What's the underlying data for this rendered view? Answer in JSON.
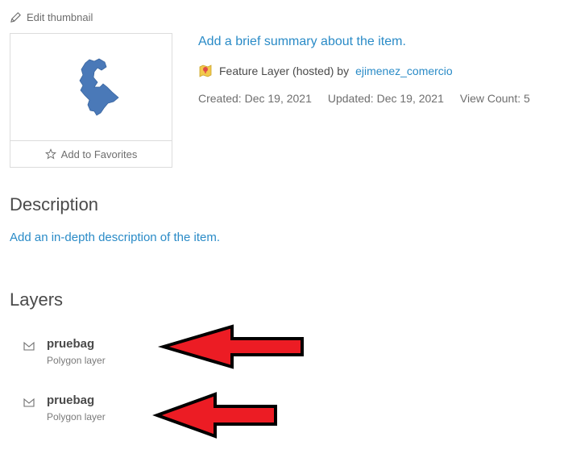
{
  "thumbnail": {
    "edit_label": "Edit thumbnail",
    "favorites_label": "Add to Favorites",
    "shape_color": "#4a79b8"
  },
  "item": {
    "summary_placeholder": "Add a brief summary about the item.",
    "type_label": "Feature Layer (hosted) by",
    "owner": "ejimenez_comercio",
    "created": "Created: Dec 19, 2021",
    "updated": "Updated: Dec 19, 2021",
    "view_count": "View Count: 5"
  },
  "description": {
    "title": "Description",
    "placeholder": "Add an in-depth description of the item."
  },
  "layers": {
    "title": "Layers",
    "items": [
      {
        "name": "pruebag",
        "type": "Polygon layer"
      },
      {
        "name": "pruebag",
        "type": "Polygon layer"
      }
    ]
  },
  "annotations": {
    "arrow_color": "#ec1c24"
  },
  "colors": {
    "link": "#2a8bc7",
    "text": "#4a4a4a",
    "muted": "#6e6e6e"
  }
}
